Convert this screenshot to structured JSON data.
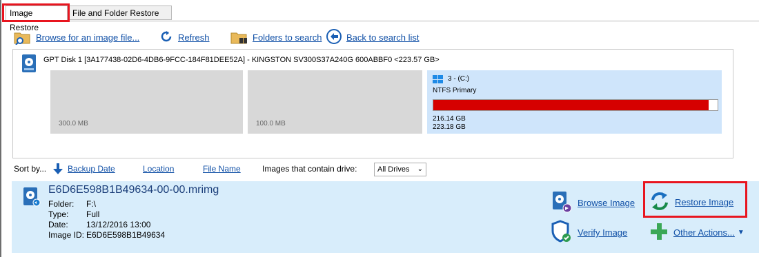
{
  "tabs": [
    {
      "label": "Image Restore",
      "active": true
    },
    {
      "label": "File and Folder Restore",
      "active": false
    }
  ],
  "toolbar": {
    "browse_label": "Browse for an image file...",
    "refresh_label": "Refresh",
    "folders_label": "Folders to search",
    "back_label": "Back to search list"
  },
  "disk": {
    "title": "GPT Disk 1 [3A177438-02D6-4DB6-9FCC-184F81DEE52A] - KINGSTON SV300S37A240G 600ABBF0  <223.57 GB>",
    "partitions": [
      {
        "size_label": "300.0 MB"
      },
      {
        "size_label": "100.0 MB"
      },
      {
        "name": "3 -  (C:)",
        "type": "NTFS Primary",
        "used": "216.14 GB",
        "total": "223.18 GB",
        "used_fraction": 0.968
      }
    ]
  },
  "sort": {
    "prefix": "Sort by...",
    "options": [
      "Backup Date",
      "Location",
      "File Name"
    ],
    "drive_label": "Images that contain drive:",
    "drive_value": "All Drives"
  },
  "image": {
    "filename": "E6D6E598B1B49634-00-00.mrimg",
    "folder_key": "Folder:",
    "folder": "F:\\",
    "type_key": "Type:",
    "type": "Full",
    "date_key": "Date:",
    "date": "13/12/2016 13:00",
    "id_key": "Image ID:",
    "id": "E6D6E598B1B49634"
  },
  "actions": {
    "browse_image": "Browse Image",
    "restore_image": "Restore Image",
    "verify_image": "Verify Image",
    "other_actions": "Other Actions..."
  },
  "colors": {
    "link": "#0f4fa6",
    "highlight_box": "#e8151f",
    "partition_used": "#d60000",
    "entry_bg": "#d8edfb"
  }
}
